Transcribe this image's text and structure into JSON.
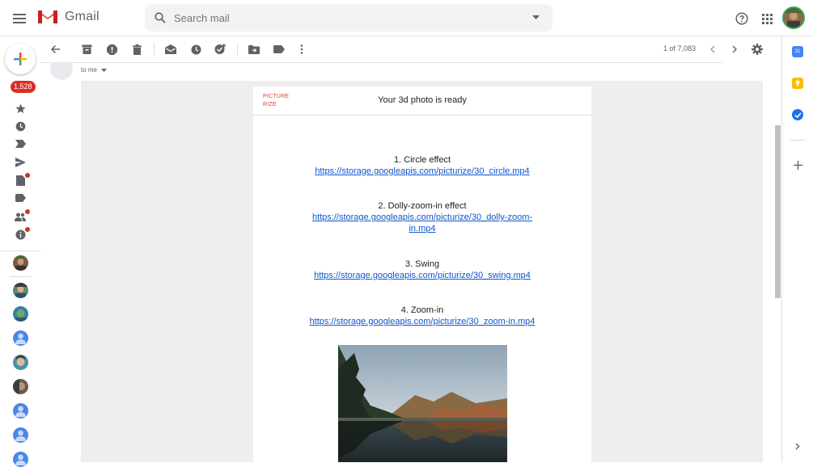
{
  "header": {
    "app_name": "Gmail",
    "search_placeholder": "Search mail",
    "menu_icon": "menu-icon",
    "help_icon": "help-icon",
    "apps_icon": "apps-grid-icon"
  },
  "leftnav": {
    "inbox_count": "1,528"
  },
  "toolbar": {
    "pager": "1 of 7,083"
  },
  "message": {
    "to_line": "to me"
  },
  "email": {
    "brand_line1": "PICTURE",
    "brand_line2": "RIZE",
    "title": "Your 3d photo is ready",
    "effects": [
      {
        "label": "1. Circle effect",
        "link": "https://storage.googleapis.com/picturize/30_circle.mp4"
      },
      {
        "label": "2. Dolly-zoom-in effect",
        "link_line1": "https://storage.googleapis.com/picturize/30_dolly-zoom-",
        "link_line2": "in.mp4"
      },
      {
        "label": "3. Swing",
        "link": "https://storage.googleapis.com/picturize/30_swing.mp4"
      },
      {
        "label": "4. Zoom-in",
        "link": "https://storage.googleapis.com/picturize/30_zoom-in.mp4"
      }
    ]
  },
  "colors": {
    "accent_red": "#d93025",
    "link_blue": "#1155cc",
    "brand_red": "#e53935"
  }
}
